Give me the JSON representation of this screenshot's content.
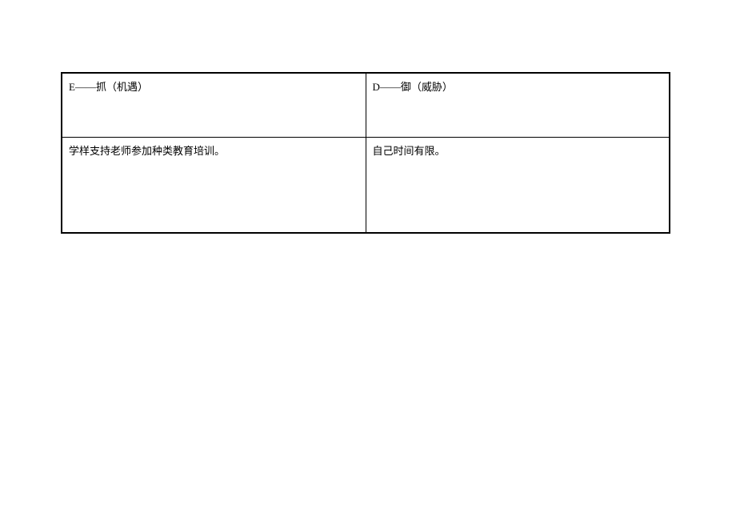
{
  "table": {
    "header": {
      "left": "E——抓（机遇）",
      "right": "D——御（威胁）"
    },
    "content": {
      "left": "学样支持老师参加种类教育培训。",
      "right": "自己时间有限。"
    }
  }
}
